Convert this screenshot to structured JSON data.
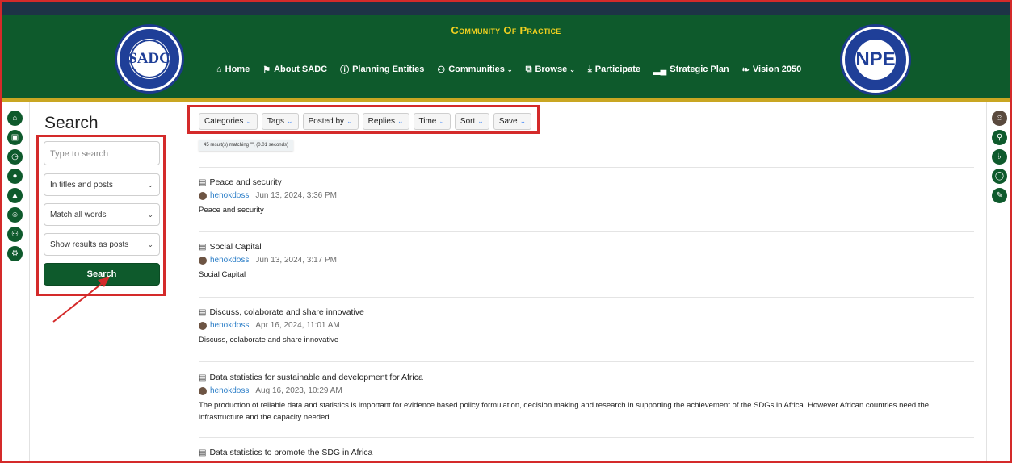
{
  "header": {
    "site_title": "Community Of Practice",
    "sadc_logo_text": "SADC",
    "npe_logo_text": "NPE"
  },
  "nav": [
    {
      "label": "Home",
      "icon": "home-icon"
    },
    {
      "label": "About SADC",
      "icon": "flag-icon"
    },
    {
      "label": "Planning Entities",
      "icon": "info-icon"
    },
    {
      "label": "Communities",
      "icon": "users-icon",
      "dropdown": true
    },
    {
      "label": "Browse",
      "icon": "window-icon",
      "dropdown": true
    },
    {
      "label": "Participate",
      "icon": "download-icon"
    },
    {
      "label": "Strategic Plan",
      "icon": "signal-icon"
    },
    {
      "label": "Vision 2050",
      "icon": "leaf-icon"
    }
  ],
  "left_rail": [
    "home-icon",
    "inbox-icon",
    "clock-icon",
    "tags-icon",
    "fire-icon",
    "user-icon",
    "group-icon",
    "cogs-icon"
  ],
  "right_rail": [
    "avatar-icon",
    "search-icon",
    "bell-icon",
    "chat-icon",
    "compose-icon"
  ],
  "search_panel": {
    "title": "Search",
    "input_placeholder": "Type to search",
    "in_select": "In titles and posts",
    "match_select": "Match all words",
    "show_select": "Show results as posts",
    "button_label": "Search"
  },
  "filters": [
    "Categories",
    "Tags",
    "Posted by",
    "Replies",
    "Time",
    "Sort",
    "Save"
  ],
  "match_text": "45 result(s) matching \"\", (0.01 seconds)",
  "results": [
    {
      "title": "Peace and security",
      "user": "henokdoss",
      "date": "Jun 13, 2024, 3:36 PM",
      "body": "Peace and security"
    },
    {
      "title": "Social Capital",
      "user": "henokdoss",
      "date": "Jun 13, 2024, 3:17 PM",
      "body": "Social Capital"
    },
    {
      "title": "Discuss, colaborate and share innovative",
      "user": "henokdoss",
      "date": "Apr 16, 2024, 11:01 AM",
      "body": "Discuss, colaborate and share innovative"
    },
    {
      "title": "Data statistics for sustainable and development for Africa",
      "user": "henokdoss",
      "date": "Aug 16, 2023, 10:29 AM",
      "body": "The production of reliable data and statistics is important for evidence based policy formulation, decision making and research in supporting the achievement of the SDGs in Africa. However African countries need the infrastructure and the capacity needed."
    },
    {
      "title": "Data statistics to promote the SDG in Africa",
      "user": "",
      "date": "",
      "body": ""
    }
  ],
  "colors": {
    "brand_green": "#0e5a2c",
    "gold": "#f0d020",
    "annotation_red": "#d42a2a",
    "link_blue": "#2d7fc8"
  }
}
